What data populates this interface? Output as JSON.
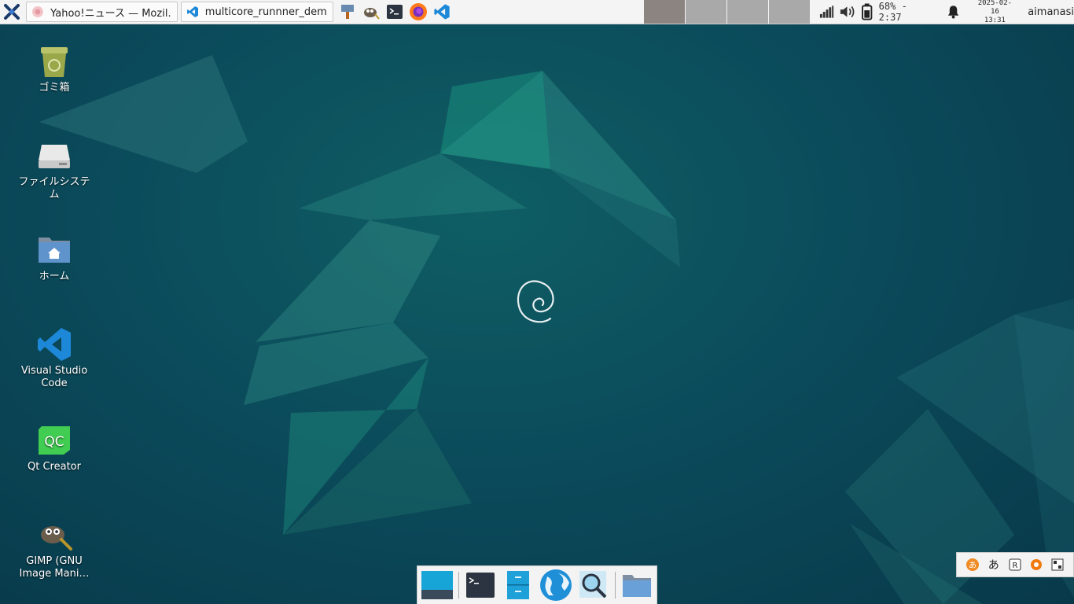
{
  "taskbar": {
    "tasks": [
      {
        "title": "Yahoo!ニュース — Mozil…",
        "icon": "firefox-tab-icon"
      },
      {
        "title": "multicore_runnner_dem…",
        "icon": "vscode-icon"
      }
    ],
    "launchers": [
      "desktop-tool-icon",
      "gimp-icon",
      "terminal-icon",
      "firefox-icon",
      "vscode-icon"
    ],
    "workspaces": 4,
    "active_workspace": 1
  },
  "tray": {
    "battery_text": "68% - 2:37",
    "date": "2025-02-16",
    "time": "13:31",
    "user": "aimanasi"
  },
  "desktop_icons": [
    {
      "label": "ゴミ箱",
      "icon": "trash-icon"
    },
    {
      "label": "ファイルシステム",
      "icon": "drive-icon"
    },
    {
      "label": "ホーム",
      "icon": "home-folder-icon"
    },
    {
      "label": "Visual Studio Code",
      "icon": "vscode-icon"
    },
    {
      "label": "Qt Creator",
      "icon": "qt-creator-icon"
    },
    {
      "label": "GIMP (GNU Image Mani…",
      "icon": "gimp-icon"
    }
  ],
  "ime": {
    "hiragana_label": "あ",
    "r_label": "R",
    "qc_label": "QC"
  },
  "dock": {
    "items": [
      "show-desktop-icon",
      "terminal-icon",
      "file-manager-icon",
      "web-browser-icon",
      "search-icon",
      "folder-icon"
    ]
  },
  "colors": {
    "panel_bg": "#f4f4f4",
    "desktop_bg": "#0b4b5b",
    "accent_teal": "#1aa39a",
    "vscode_blue": "#1e88d8",
    "qt_green": "#41cd52"
  }
}
